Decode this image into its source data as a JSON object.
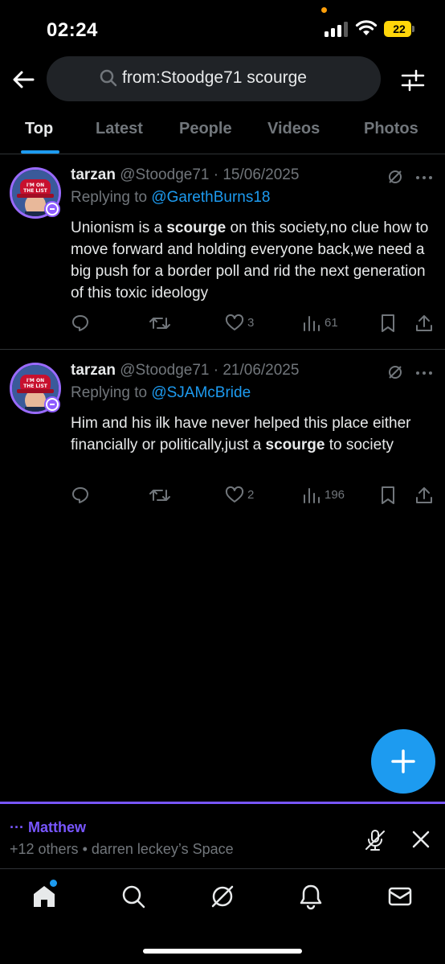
{
  "status_bar": {
    "time": "02:24",
    "battery": "22"
  },
  "search": {
    "query": "from:Stoodge71 scourge"
  },
  "tabs": [
    {
      "label": "Top",
      "active": true
    },
    {
      "label": "Latest",
      "active": false
    },
    {
      "label": "People",
      "active": false
    },
    {
      "label": "Videos",
      "active": false
    },
    {
      "label": "Photos",
      "active": false
    }
  ],
  "tweets": [
    {
      "name": "tarzan",
      "meta": "@Stoodge71 · 15/06/2025",
      "replying_prefix": "Replying to ",
      "replying_to": "@GarethBurns18",
      "text_1": "Unionism is a ",
      "highlight": "scourge",
      "text_2": " on this society,no clue how to move forward and holding everyone back,we need a big push for a border poll and rid the next generation of this toxic ideology",
      "likes": "3",
      "views": "61"
    },
    {
      "name": "tarzan",
      "meta": "@Stoodge71 · 21/06/2025",
      "replying_prefix": "Replying to ",
      "replying_to": "@SJAMcBride",
      "text_1": "Him and his ilk have never helped this place either financially or politically,just a ",
      "highlight": "scourge",
      "text_2": " to society",
      "likes": "2",
      "views": "196"
    }
  ],
  "avatar_text": {
    "line1": "I'M ON",
    "line2": "THE LIST"
  },
  "space": {
    "host": "··· Matthew",
    "subtitle": "+12 others • darren leckey’s Space"
  },
  "colors": {
    "accent": "#1d9bf0",
    "space": "#7856ff",
    "battery": "#ffd60a"
  },
  "icons": [
    "back-arrow-icon",
    "search-icon",
    "filter-icon",
    "grok-icon",
    "more-icon",
    "reply-icon",
    "retweet-icon",
    "like-icon",
    "views-icon",
    "bookmark-icon",
    "share-icon",
    "plus-icon",
    "mic-off-icon",
    "close-icon",
    "home-icon",
    "explore-icon",
    "notifications-icon",
    "messages-icon"
  ]
}
